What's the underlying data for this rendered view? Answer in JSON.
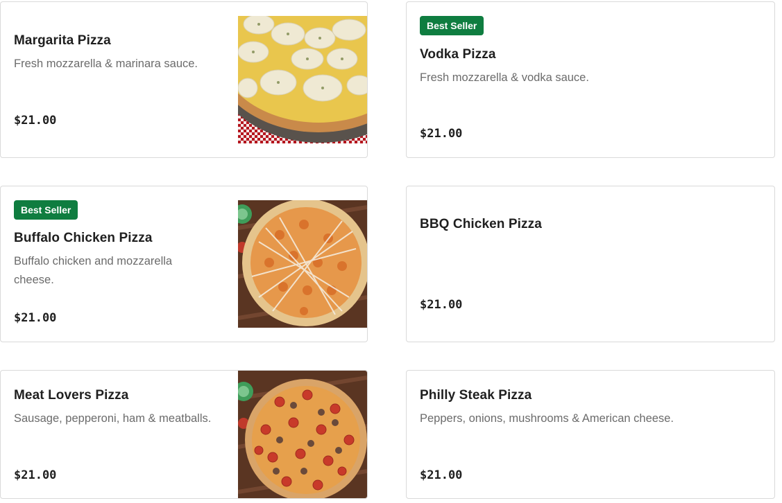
{
  "menu": {
    "items": [
      {
        "name": "Margarita Pizza",
        "description": "Fresh mozzarella & marinara sauce.",
        "price": "$21.00",
        "badge": null,
        "image": "margarita-pizza-image"
      },
      {
        "name": "Vodka Pizza",
        "description": "Fresh mozzarella & vodka sauce.",
        "price": "$21.00",
        "badge": "Best Seller",
        "image": null
      },
      {
        "name": "Buffalo Chicken Pizza",
        "description": "Buffalo chicken and mozzarella cheese.",
        "price": "$21.00",
        "badge": "Best Seller",
        "image": "buffalo-chicken-pizza-image"
      },
      {
        "name": "BBQ Chicken Pizza",
        "description": "",
        "price": "$21.00",
        "badge": null,
        "image": null
      },
      {
        "name": "Meat Lovers Pizza",
        "description": "Sausage, pepperoni, ham & meatballs.",
        "price": "$21.00",
        "badge": null,
        "image": "meat-lovers-pizza-image"
      },
      {
        "name": "Philly Steak Pizza",
        "description": "Peppers, onions, mushrooms & American cheese.",
        "price": "$21.00",
        "badge": null,
        "image": null
      }
    ]
  },
  "colors": {
    "badge_bg": "#0f7d40",
    "title": "#1f1f1f",
    "description": "#6b6b6b",
    "border": "#d9d9d9"
  }
}
